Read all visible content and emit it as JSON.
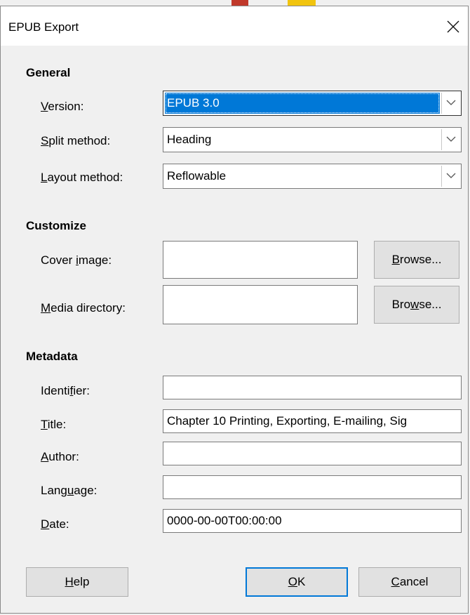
{
  "window": {
    "title": "EPUB Export"
  },
  "sections": {
    "general": "General",
    "customize": "Customize",
    "metadata": "Metadata"
  },
  "general": {
    "version": {
      "label_pre": "",
      "label_u": "V",
      "label_post": "ersion:",
      "value": "EPUB 3.0"
    },
    "split": {
      "label_pre": "",
      "label_u": "S",
      "label_post": "plit method:",
      "value": "Heading"
    },
    "layout": {
      "label_pre": "",
      "label_u": "L",
      "label_post": "ayout method:",
      "value": "Reflowable"
    }
  },
  "customize": {
    "cover": {
      "label_pre": "Cover ",
      "label_u": "i",
      "label_post": "mage:",
      "value": "",
      "button_pre": "",
      "button_u": "B",
      "button_post": "rowse..."
    },
    "media": {
      "label_pre": "",
      "label_u": "M",
      "label_post": "edia directory:",
      "value": "",
      "button_pre": "Bro",
      "button_u": "w",
      "button_post": "se..."
    }
  },
  "metadata": {
    "identifier": {
      "label_pre": "Identi",
      "label_u": "f",
      "label_post": "ier:",
      "value": ""
    },
    "title": {
      "label_pre": "",
      "label_u": "T",
      "label_post": "itle:",
      "value": "Chapter 10  Printing, Exporting, E-mailing, Sig"
    },
    "author": {
      "label_pre": "",
      "label_u": "A",
      "label_post": "uthor:",
      "value": ""
    },
    "language": {
      "label_pre": "Lang",
      "label_u": "u",
      "label_post": "age:",
      "value": ""
    },
    "date": {
      "label_pre": "",
      "label_u": "D",
      "label_post": "ate:",
      "value": "0000-00-00T00:00:00"
    }
  },
  "buttons": {
    "help": {
      "pre": "",
      "u": "H",
      "post": "elp"
    },
    "ok": {
      "pre": "",
      "u": "O",
      "post": "K"
    },
    "cancel": {
      "pre": "",
      "u": "C",
      "post": "ancel"
    }
  },
  "colors": {
    "accent": "#0078d7",
    "background": "#f0f0f0"
  }
}
